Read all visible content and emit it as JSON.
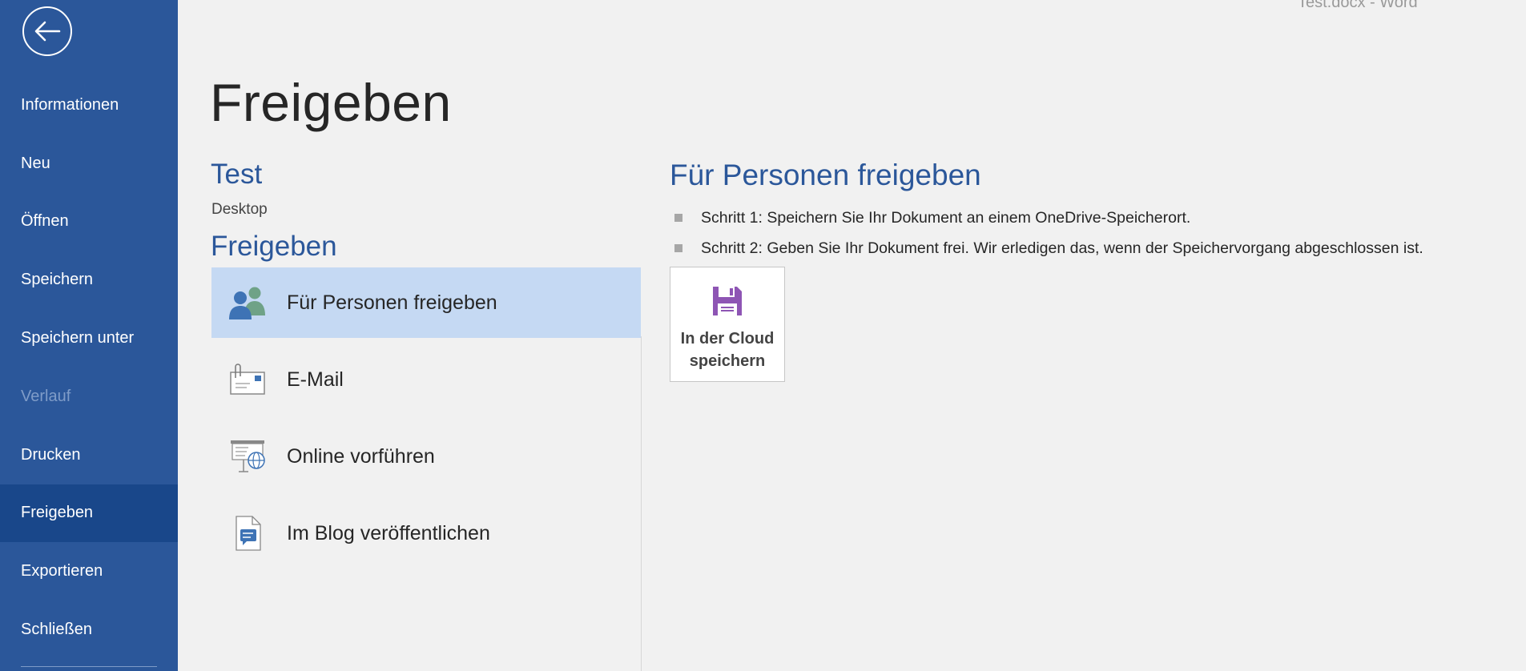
{
  "window": {
    "title": "Test.docx  -  Word"
  },
  "sidebar": {
    "items": [
      {
        "label": "Informationen"
      },
      {
        "label": "Neu"
      },
      {
        "label": "Öffnen"
      },
      {
        "label": "Speichern"
      },
      {
        "label": "Speichern unter"
      },
      {
        "label": "Verlauf"
      },
      {
        "label": "Drucken"
      },
      {
        "label": "Freigeben"
      },
      {
        "label": "Exportieren"
      },
      {
        "label": "Schließen"
      }
    ]
  },
  "main": {
    "page_title": "Freigeben",
    "document": {
      "name": "Test",
      "location": "Desktop"
    },
    "section_title": "Freigeben",
    "share_options": [
      {
        "label": "Für Personen freigeben",
        "icon": "people-icon"
      },
      {
        "label": "E-Mail",
        "icon": "email-icon"
      },
      {
        "label": "Online vorführen",
        "icon": "present-online-icon"
      },
      {
        "label": "Im Blog veröffentlichen",
        "icon": "blog-post-icon"
      }
    ]
  },
  "detail": {
    "title": "Für Personen freigeben",
    "steps": [
      "Schritt 1: Speichern Sie Ihr Dokument an einem OneDrive-Speicherort.",
      "Schritt 2: Geben Sie Ihr Dokument frei. Wir erledigen das, wenn der Speichervorgang abgeschlossen ist."
    ],
    "cloud_button": {
      "line1": "In der Cloud",
      "line2": "speichern",
      "icon": "save-icon"
    }
  },
  "colors": {
    "sidebar": "#2b579a",
    "sidebar_active": "#19478a",
    "accent": "#2b579a",
    "selected": "#c5d9f3",
    "save_icon": "#8e55b4"
  }
}
